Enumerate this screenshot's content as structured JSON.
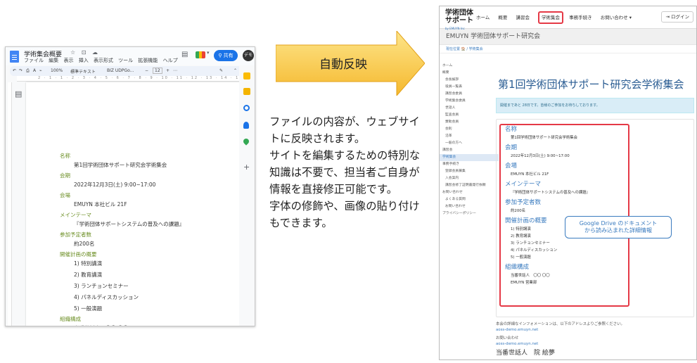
{
  "docs": {
    "title": "学術集会概要",
    "title_icons": "☆ ⊡ ☁",
    "menu": [
      "ファイル",
      "編集",
      "表示",
      "挿入",
      "表示形式",
      "ツール",
      "拡張機能",
      "ヘルプ"
    ],
    "share_label": "共有",
    "avatar": "デモ",
    "toolbar": {
      "zoom": "100%",
      "style": "標準テキスト",
      "font": "BIZ UDPGo...",
      "font_size": "12"
    },
    "ruler_numbers": "2 · 1 · 1 · 2 · 3 · 4 · 5 · 6 · 7 · 8 · 9 · 10 · 11 · 12 · 13 · 14 · 15",
    "fields": [
      {
        "label": "名称",
        "values": [
          "第1回学術団体サポート研究会学術集会"
        ]
      },
      {
        "label": "会期",
        "values": [
          "2022年12月3日(土) 9:00~17:00"
        ]
      },
      {
        "label": "会場",
        "values": [
          "EMUYN 本社ビル 21F"
        ]
      },
      {
        "label": "メインテーマ",
        "values": [
          "『学術団体サポートシステムの普及への課題』"
        ]
      },
      {
        "label": "参加予定者数",
        "values": [
          "約200名"
        ]
      },
      {
        "label": "開催計画の概要",
        "values": [
          "1) 特別講演",
          "2) 教育講演",
          "3) ランチョンセミナー",
          "4) パネルディスカッション",
          "5) 一般演題"
        ]
      },
      {
        "label": "組織構成",
        "values": [
          "当番世話人　〇〇 〇〇",
          "EMUYN 営業部"
        ]
      }
    ],
    "colors": {
      "label": "#6b8e23",
      "share": "#1a73e8"
    }
  },
  "arrow": {
    "label": "自動反映",
    "colors": {
      "fill_top": "#fde58a",
      "fill_bottom": "#f5b82e"
    }
  },
  "description": [
    "ファイルの内容が、ウェブサイトに反映されます。",
    "サイトを編集するための特別な知識は不要で、担当者ご自身が情報を直接修正可能です。",
    "字体の修飾や、画像の貼り付けもできます。"
  ],
  "site": {
    "logo": "学術団体\nサポート",
    "logo_sub": "by EMUYN Inc",
    "nav": [
      "ホーム",
      "概要",
      "講習会",
      "学術集会",
      "事務手続き",
      "お問い合わせ ▾"
    ],
    "nav_active": "学術集会",
    "login": "ログイン",
    "band_title": "EMUYN 学術団体サポート研究会",
    "breadcrumb": "現在位置 🏠 / 学術集会",
    "sidebar": [
      {
        "label": "ホーム",
        "sub": false,
        "cur": false
      },
      {
        "label": "概要",
        "sub": false,
        "cur": false
      },
      {
        "label": "会長挨拶",
        "sub": true,
        "cur": false
      },
      {
        "label": "役員一覧表",
        "sub": true,
        "cur": false
      },
      {
        "label": "講習会委員",
        "sub": true,
        "cur": false
      },
      {
        "label": "学術集会委員",
        "sub": true,
        "cur": false
      },
      {
        "label": "世話人",
        "sub": true,
        "cur": false
      },
      {
        "label": "監査会員",
        "sub": true,
        "cur": false
      },
      {
        "label": "賛助会員",
        "sub": true,
        "cur": false
      },
      {
        "label": "会則",
        "sub": true,
        "cur": false
      },
      {
        "label": "沿革",
        "sub": true,
        "cur": false
      },
      {
        "label": "一般の方へ",
        "sub": true,
        "cur": false
      },
      {
        "label": "講習会",
        "sub": false,
        "cur": false
      },
      {
        "label": "学術集会",
        "sub": false,
        "cur": true
      },
      {
        "label": "事務手続き",
        "sub": false,
        "cur": false
      },
      {
        "label": "登録会員募集",
        "sub": true,
        "cur": false
      },
      {
        "label": "入会案内",
        "sub": true,
        "cur": false
      },
      {
        "label": "講習会修了証明書発行依頼",
        "sub": true,
        "cur": false
      },
      {
        "label": "お問い合わせ",
        "sub": false,
        "cur": false
      },
      {
        "label": "よくある質問",
        "sub": true,
        "cur": false
      },
      {
        "label": "お問い合わせ",
        "sub": true,
        "cur": false
      },
      {
        "label": "プライバシーポリシー",
        "sub": false,
        "cur": false
      }
    ],
    "page_title": "第1回学術団体サポート研究会学術集会",
    "notice": "開催まであと 28日です。皆様のご参加をお待ちしております。",
    "fields": [
      {
        "label": "名称",
        "values": [
          "第1回学術団体サポート研究会学術集会"
        ]
      },
      {
        "label": "会期",
        "values": [
          "2022年12月3日(土) 9:00~17:00"
        ]
      },
      {
        "label": "会場",
        "values": [
          "EMUYN 本社ビル 21F"
        ]
      },
      {
        "label": "メインテーマ",
        "values": [
          "『学術団体サポートシステムの普及への課題』"
        ]
      },
      {
        "label": "参加予定者数",
        "values": [
          "約200名"
        ]
      },
      {
        "label": "開催計画の概要",
        "values": [
          "1) 特別講演",
          "2) 教育講演",
          "3) ランチョンセミナー",
          "4) パネルディスカッション",
          "5) 一般演題"
        ]
      },
      {
        "label": "組織構成",
        "values": [
          "当番世話人　〇〇 〇〇",
          "EMUYN 営業部"
        ]
      }
    ],
    "callout": "Google Drive のドキュメント\nから読み込まれた詳細情報",
    "footer": {
      "info": "本会の詳細なインフォメーションは、以下のアドレスよりご参照ください。",
      "info_link": "aoss-demo.emuyn.net",
      "contact": "お問い合わせ",
      "contact_link": "aoss-demo.emuyn.net",
      "person": "当番世話人　院 絵夢"
    },
    "colors": {
      "accent": "#3a7bbf",
      "highlight": "#e53946",
      "notice_bg": "#d9edf7"
    }
  }
}
